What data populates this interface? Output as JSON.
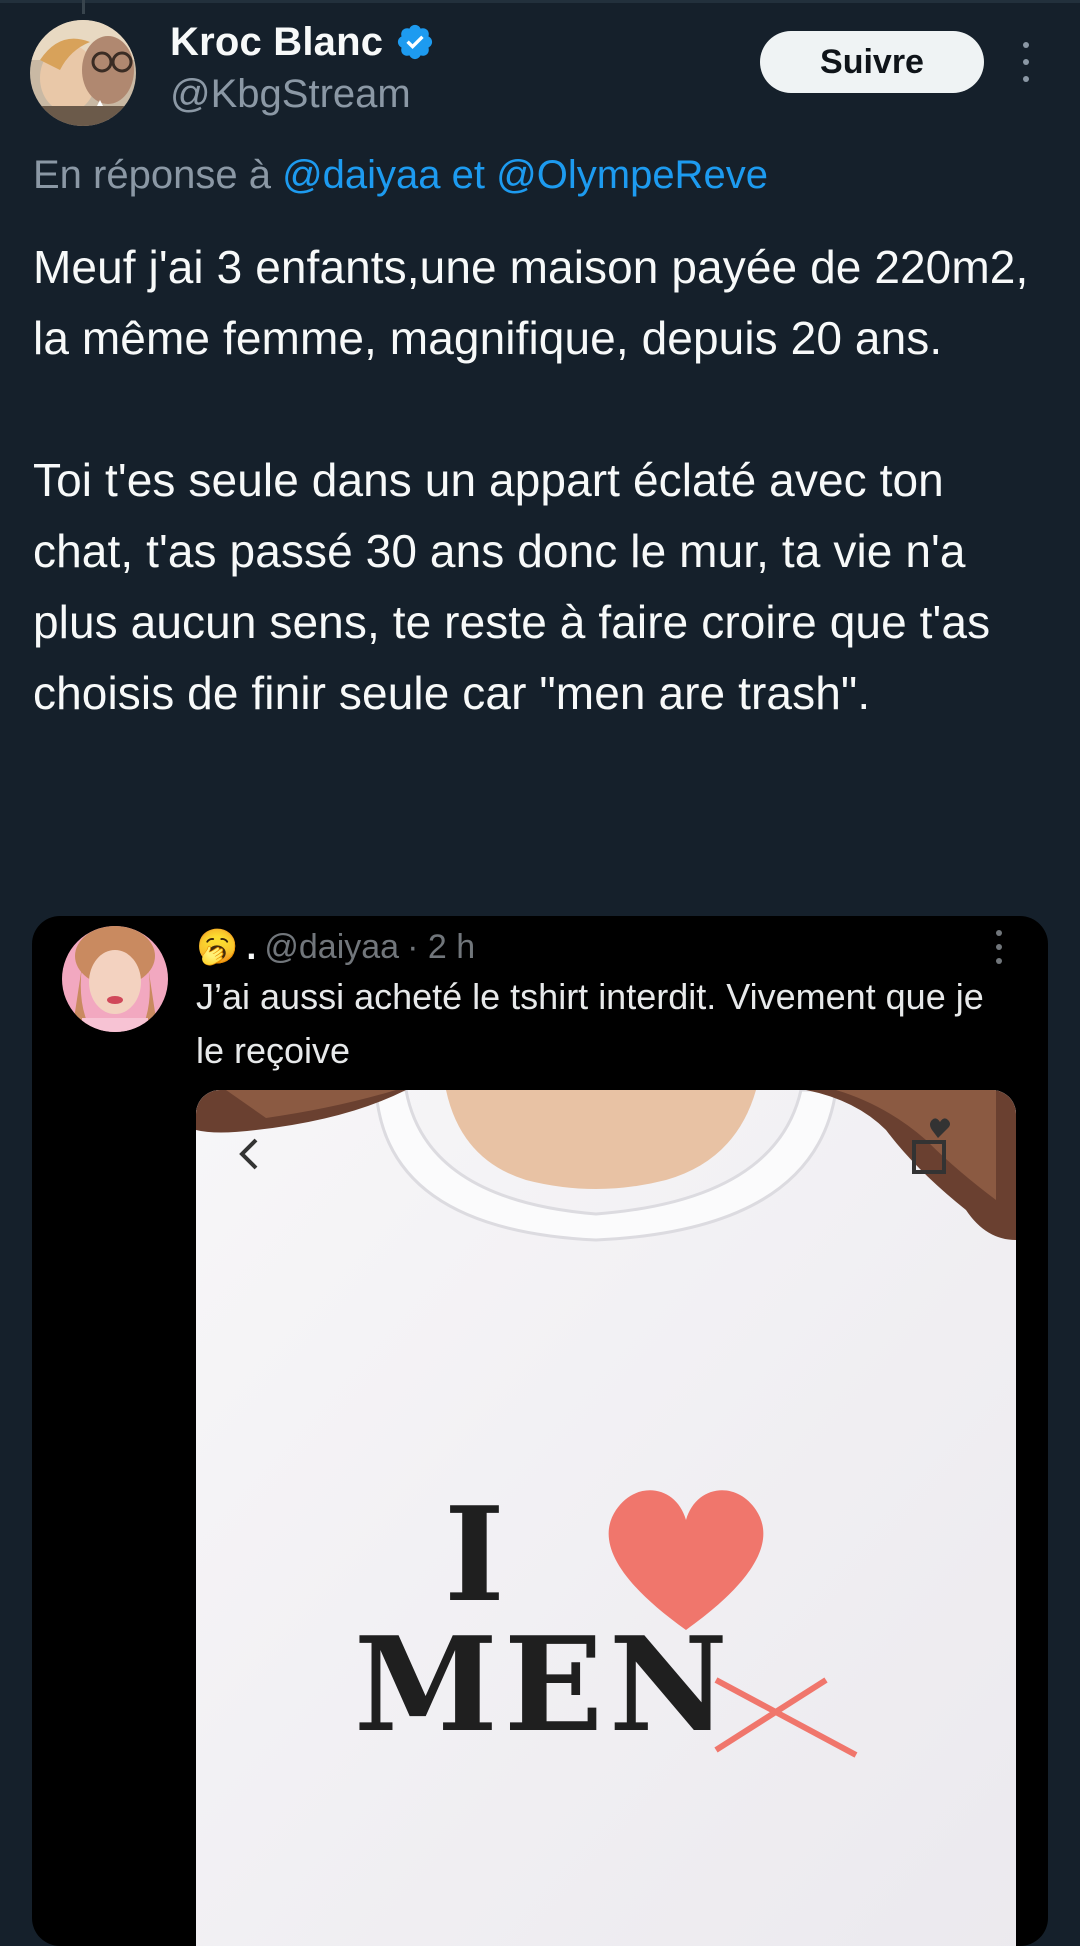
{
  "author": {
    "display_name": "Kroc Blanc",
    "handle": "@KbgStream",
    "verified": true
  },
  "follow_button_label": "Suivre",
  "reply": {
    "prefix": "En réponse à ",
    "mention_1": "@daiyaa",
    "conjunction": " et ",
    "mention_2": "@OlympeReve"
  },
  "tweet_text": "Meuf j'ai 3 enfants,une maison payée de 220m2, la même femme, magnifique, depuis 20 ans.\n\nToi t'es seule dans un appart éclaté avec ton chat, t'as passé 30 ans donc le mur, ta vie n'a plus aucun sens, te reste à faire croire que t'as choisis de finir seule car \"men are trash\".",
  "quoted_tweet": {
    "emoji": "🥱",
    "dot": ".",
    "handle": "@daiyaa",
    "time": "· 2 h",
    "text": "J’ai aussi acheté le tshirt interdit. Vivement que je le reçoive",
    "media": {
      "description_icon": "tshirt-photo",
      "shirt_text_top": "I",
      "shirt_text_bottom": "MEN",
      "heart_color": "#f0766c"
    }
  },
  "colors": {
    "background": "#15202b",
    "accent": "#1d9bf0",
    "secondary_text": "#8b98a5"
  }
}
